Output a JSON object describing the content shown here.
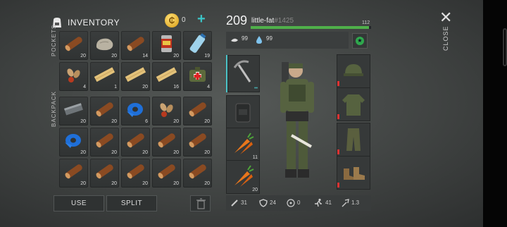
{
  "inventory": {
    "title": "INVENTORY",
    "coins": "0",
    "pockets_label": "POCKETS",
    "backpack_label": "BACKPACK",
    "pockets": [
      {
        "item": "log",
        "count": "20"
      },
      {
        "item": "stone",
        "count": "20"
      },
      {
        "item": "log",
        "count": "14"
      },
      {
        "item": "canned-food",
        "count": "20"
      },
      {
        "item": "water-bottle",
        "count": "19"
      },
      {
        "item": "seeds",
        "count": "4"
      },
      {
        "item": "plank",
        "count": "1"
      },
      {
        "item": "plank",
        "count": "20"
      },
      {
        "item": "plank",
        "count": "16"
      },
      {
        "item": "medkit",
        "count": "4"
      }
    ],
    "backpack": [
      {
        "item": "iron-bar",
        "count": "20"
      },
      {
        "item": "log",
        "count": "20"
      },
      {
        "item": "duct-tape",
        "count": "6"
      },
      {
        "item": "seeds",
        "count": "20"
      },
      {
        "item": "log",
        "count": "20"
      },
      {
        "item": "duct-tape",
        "count": "20"
      },
      {
        "item": "log",
        "count": "20"
      },
      {
        "item": "log",
        "count": "20"
      },
      {
        "item": "log",
        "count": "20"
      },
      {
        "item": "log",
        "count": "20"
      },
      {
        "item": "log",
        "count": "20"
      },
      {
        "item": "log",
        "count": "20"
      },
      {
        "item": "log",
        "count": "20"
      },
      {
        "item": "log",
        "count": "20"
      },
      {
        "item": "log",
        "count": "20"
      }
    ],
    "use_label": "USE",
    "split_label": "SPLIT"
  },
  "character": {
    "level": "209",
    "name": "little-fat",
    "tag": "#1425",
    "hp": "112",
    "hp_fraction": 0.98,
    "food": "99",
    "water": "99",
    "quick_slots": [
      {
        "item": "pickaxe",
        "count": ""
      },
      {
        "item": "backpack",
        "count": ""
      },
      {
        "item": "carrot",
        "count": "11"
      },
      {
        "item": "carrot",
        "count": "20"
      }
    ],
    "gear_slots": [
      {
        "item": "helmet"
      },
      {
        "item": "jacket"
      },
      {
        "item": "pants"
      },
      {
        "item": "boots"
      }
    ],
    "stats": {
      "attack": "31",
      "defense": "24",
      "radiation": "0",
      "speed": "41",
      "damage": "1.3"
    }
  },
  "close_label": "CLOSE",
  "colors": {
    "accent": "#3bc6c8",
    "hp": "#4fb04a",
    "durability": "#d33333"
  }
}
